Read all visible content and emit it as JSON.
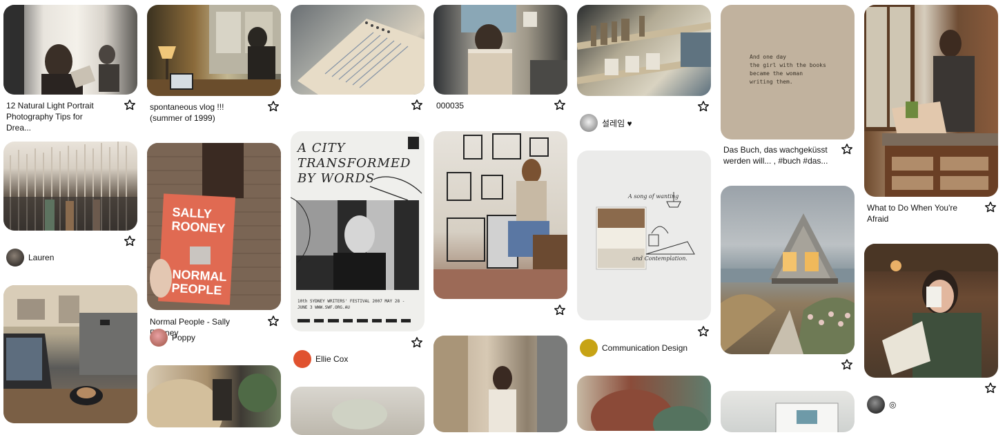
{
  "pins": {
    "c1p1": {
      "caption": "12 Natural Light Portrait Photography Tips for Drea..."
    },
    "c1p2": {
      "user": "Lauren"
    },
    "c2p1": {
      "caption": "spontaneous vlog !!! (summer of 1999)"
    },
    "c2p2": {
      "caption": "Normal People - Sally Rooney",
      "user": "Poppy",
      "book_line1": "SALLY",
      "book_line2": "ROONEY",
      "book_line3": "NORMAL",
      "book_line4": "PEOPLE"
    },
    "c3p2": {
      "user": "Ellie Cox",
      "poster_title": "A CITY\nTRANSFORMED\nBY WORDS",
      "poster_footer": "10th SYDNEY WRITERS' FESTIVAL 2007  MAY 28 - JUNE 3  WWW.SWF.ORG.AU"
    },
    "c4p1": {
      "caption": "000035"
    },
    "c5p1": {
      "user": "설레임 ♥"
    },
    "c5p2": {
      "user": "Communication Design",
      "sketch_text": "A song of wanting",
      "sketch_text2": "and Contemplation."
    },
    "c6p1": {
      "caption": "Das Buch, das wachgeküsst werden will... , #buch #das...",
      "quote": "And one day\nthe girl with the books\nbecame the woman\nwriting them."
    },
    "c7p1": {
      "caption": "What to Do When You're Afraid"
    },
    "c7p2": {
      "user": "◎"
    }
  },
  "icons": {
    "save": "star-outline-icon"
  },
  "colors": {
    "background": "#ffffff",
    "text": "#111111"
  }
}
